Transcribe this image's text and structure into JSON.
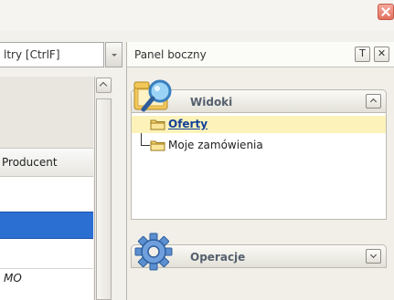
{
  "window": {
    "close_label": ""
  },
  "filter": {
    "text": "ltry [CtrlF]"
  },
  "grid": {
    "column_header": "Producent",
    "rows": [
      {
        "text": ""
      },
      {
        "text": ""
      },
      {
        "text": "MO"
      }
    ]
  },
  "side_panel": {
    "title": "Panel boczny",
    "pin_label": "Т",
    "close_label": "✕",
    "groups": [
      {
        "title": "Widoki",
        "icon": "magnifier-folder-icon",
        "collapse": "chevron-up-icon",
        "items": [
          {
            "label": "Oferty",
            "selected": true,
            "icon": "folder-icon"
          },
          {
            "label": "Moje zamówienia",
            "selected": false,
            "icon": "folder-icon"
          }
        ]
      },
      {
        "title": "Operacje",
        "icon": "gear-icon",
        "collapse": "chevron-down-icon"
      }
    ]
  },
  "colors": {
    "selection_blue": "#2b6fd3",
    "tree_highlight": "#fdf3ba",
    "group_title": "#56606e",
    "link_blue": "#12409a"
  }
}
